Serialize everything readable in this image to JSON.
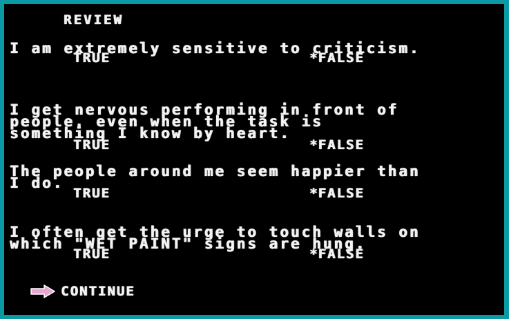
{
  "screen": {
    "title": "REVIEW"
  },
  "questions": [
    {
      "statement": "I am extremely sensitive to criticism.",
      "true_label": "TRUE",
      "false_label": "FALSE",
      "selected": "FALSE",
      "selection_marker": "*"
    },
    {
      "statement": "I get nervous performing in front of\npeople, even when the task is\nsomething I know by heart.",
      "true_label": "TRUE",
      "false_label": "FALSE",
      "selected": "FALSE",
      "selection_marker": "*"
    },
    {
      "statement": "The people around me seem happier than\nI do.",
      "true_label": "TRUE",
      "false_label": "FALSE",
      "selected": "FALSE",
      "selection_marker": "*"
    },
    {
      "statement": "I often get the urge to touch walls on\nwhich \"WET PAINT\" signs are hung.",
      "true_label": "TRUE",
      "false_label": "FALSE",
      "selected": "FALSE",
      "selection_marker": "*"
    }
  ],
  "continue": {
    "label": "CONTINUE",
    "icon": "right-arrow-icon",
    "icon_color": "#e8a6d0"
  },
  "colors": {
    "border": "#0a9aa6",
    "background": "#000000",
    "text": "#f3f3f3"
  }
}
